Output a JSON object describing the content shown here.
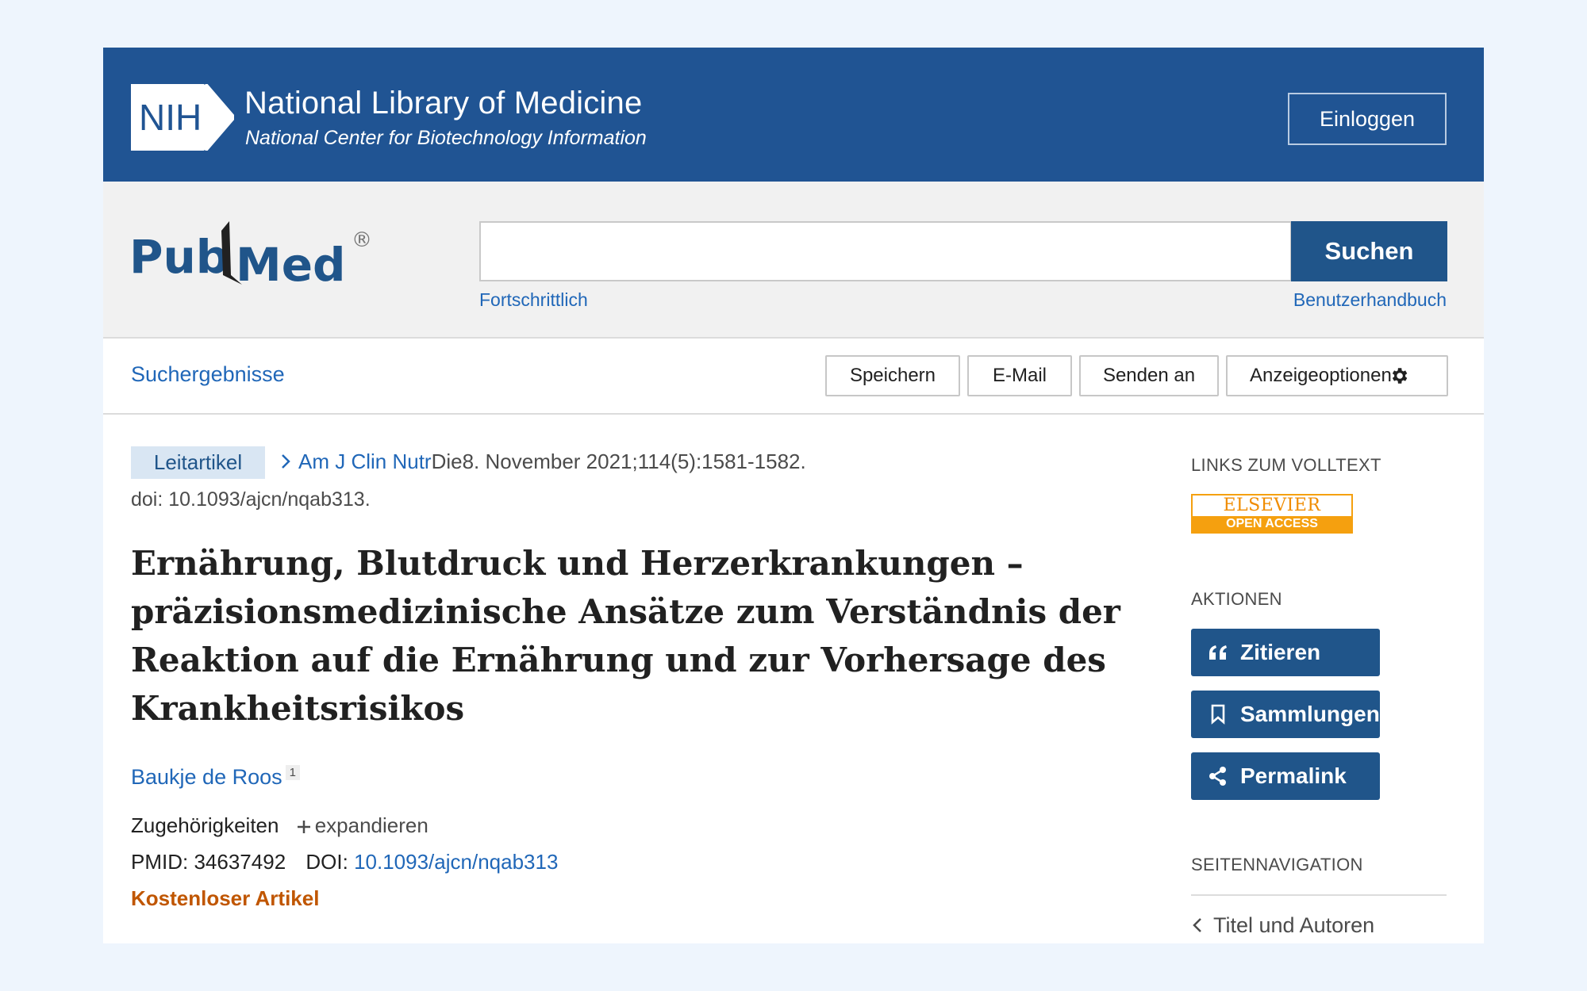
{
  "header": {
    "nih_logo_text": "NIH",
    "title": "National Library of Medicine",
    "subtitle": "National Center for Biotechnology Information",
    "login_label": "Einloggen"
  },
  "search": {
    "logo_text_left": "Pub",
    "logo_text_right": "Med",
    "logo_registered": "®",
    "query": "",
    "button_label": "Suchen",
    "advanced_label": "Fortschrittlich",
    "user_guide_label": "Benutzerhandbuch"
  },
  "toolbar": {
    "results_label": "Suchergebnisse",
    "save_label": "Speichern",
    "email_label": "E-Mail",
    "send_to_label": "Senden an",
    "display_options_label": "Anzeigeoptionen"
  },
  "article": {
    "type_badge": "Leitartikel",
    "journal": "Am J Clin Nutr",
    "citation": "Die8. November 2021;114(5):1581-1582.",
    "doi_line": "doi: 10.1093/ajcn/nqab313.",
    "title": "Ernährung, Blutdruck und Herzerkrankungen – präzisionsmedizinische Ansätze zum Verständnis der Reaktion auf die Ernährung und zur Vorhersage des Krankheitsrisikos",
    "author": "Baukje de Roos",
    "author_sup": "1",
    "affiliations_label": "Zugehörigkeiten",
    "expand_label": "expandieren",
    "pmid_label": "PMID:",
    "pmid": "34637492",
    "doi_label": "DOI:",
    "doi": "10.1093/ajcn/nqab313",
    "free_label": "Kostenloser Artikel"
  },
  "sidebar": {
    "fulltext_heading": "LINKS ZUM VOLLTEXT",
    "elsevier_top": "ELSEVIER",
    "elsevier_bottom": "OPEN ACCESS",
    "actions_heading": "AKTIONEN",
    "cite_label": "Zitieren",
    "collections_label": "Sammlungen",
    "permalink_label": "Permalink",
    "page_nav_heading": "SEITENNAVIGATION",
    "nav_item": "Titel und Autoren"
  },
  "colors": {
    "nih_blue": "#205493",
    "link_blue": "#2067b8",
    "free_orange": "#c05600",
    "elsevier_orange": "#f5a00f"
  }
}
